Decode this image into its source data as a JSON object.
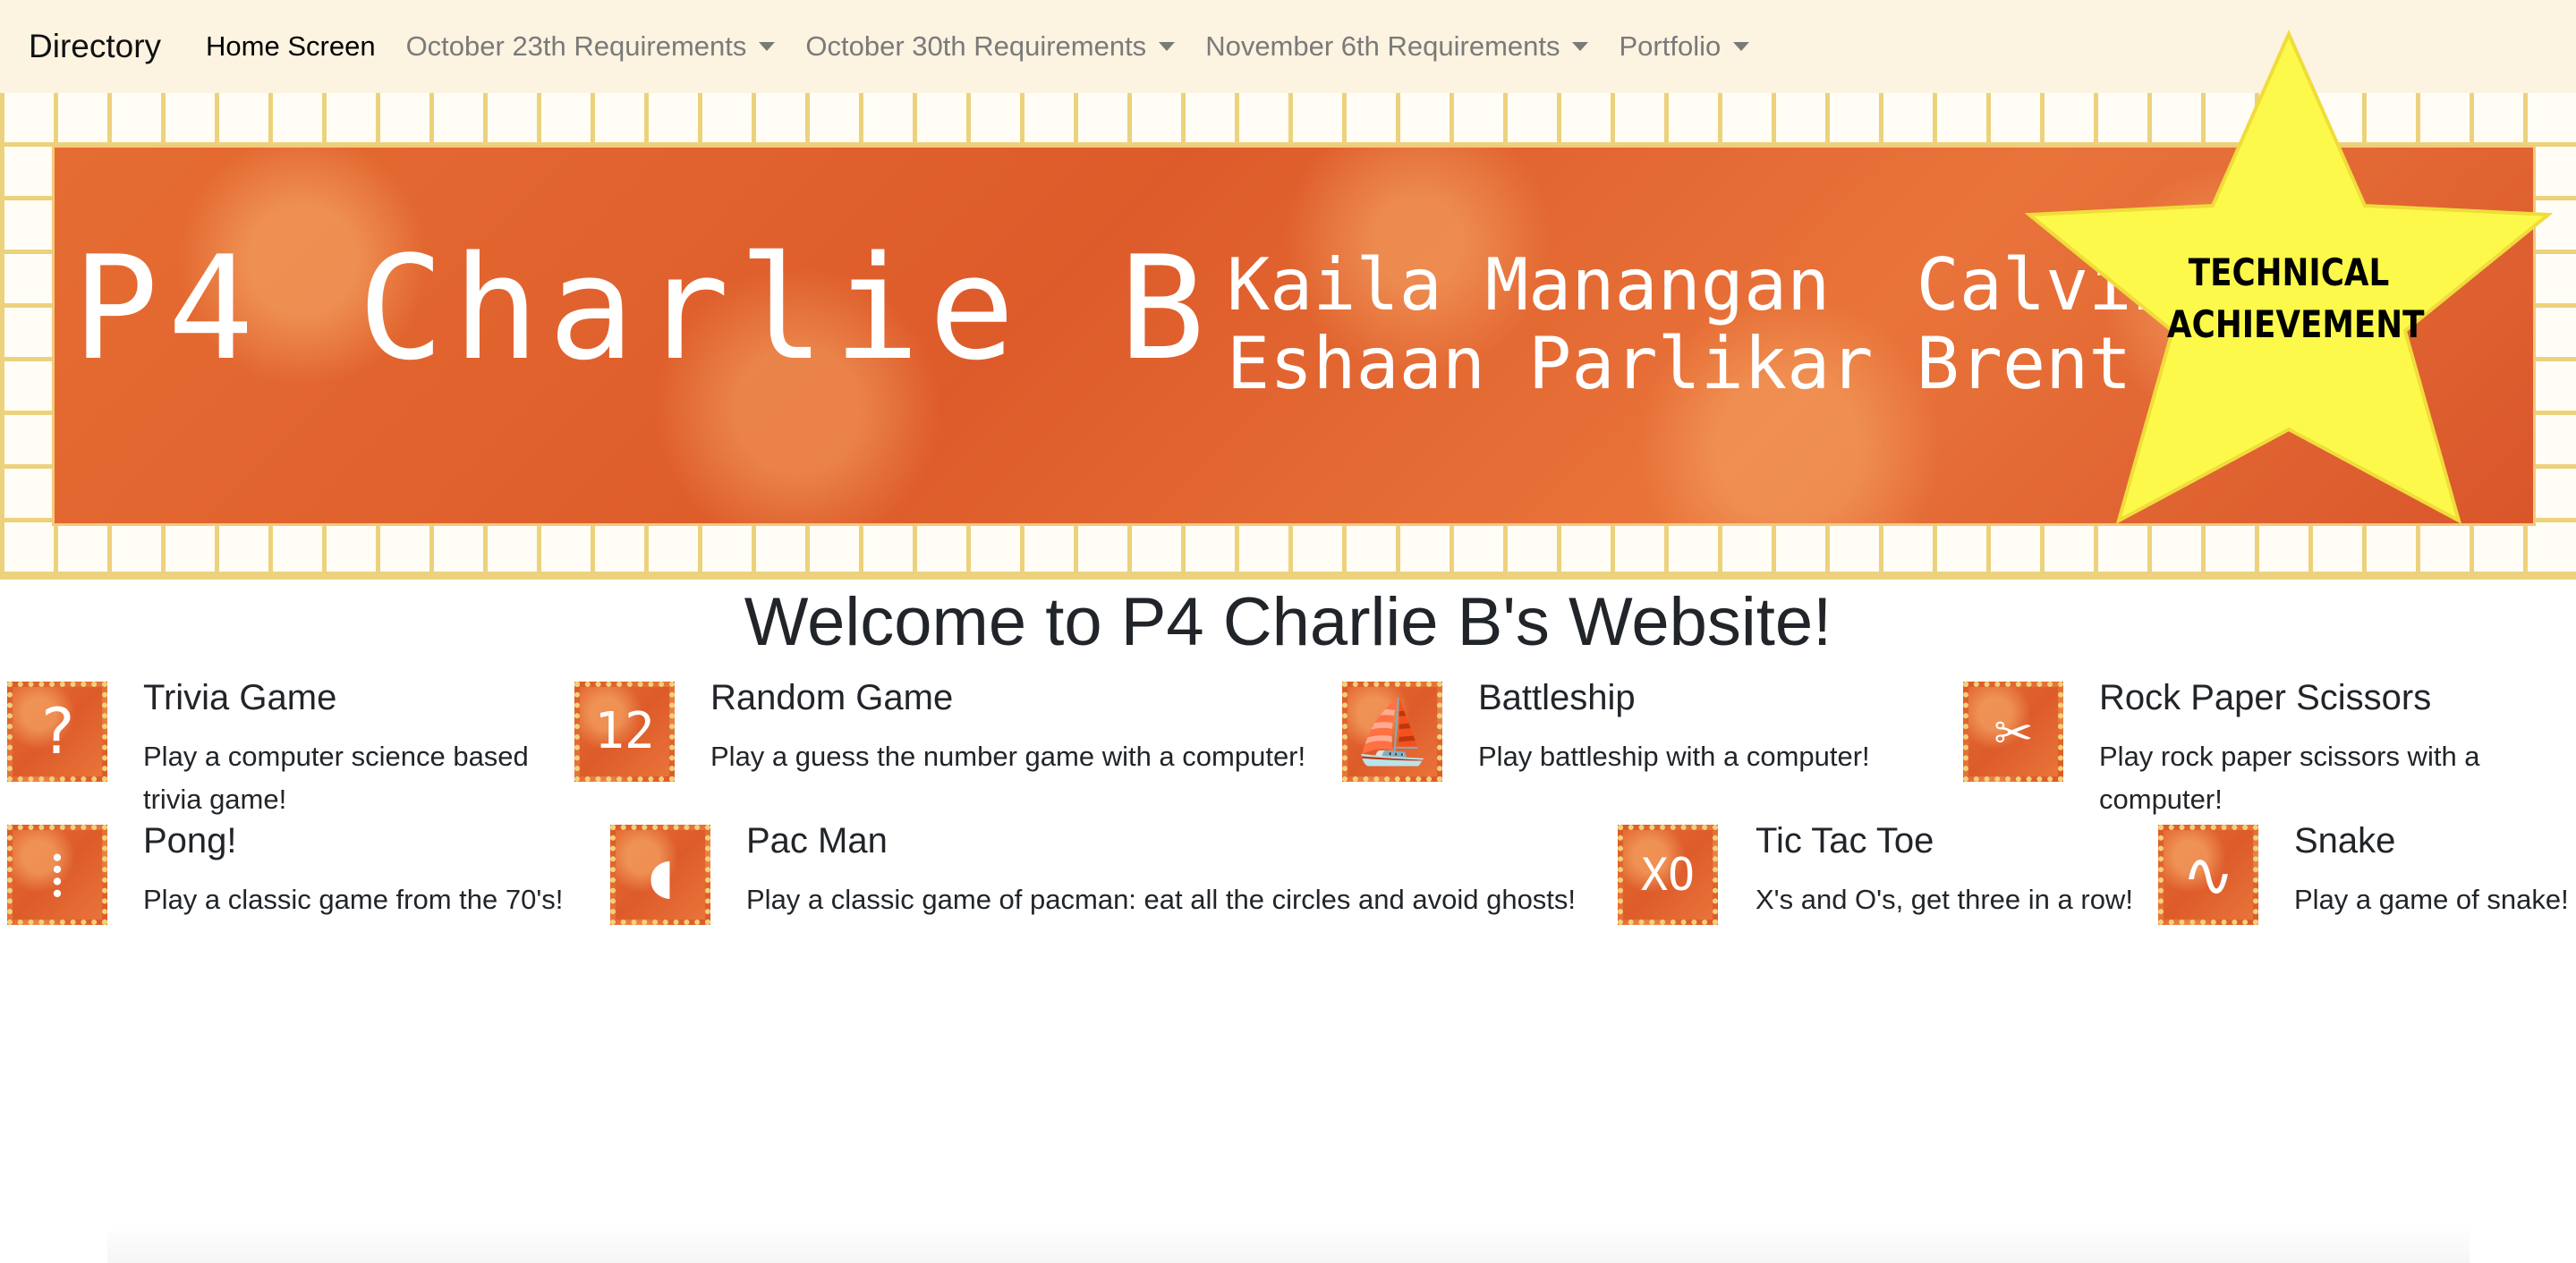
{
  "nav": {
    "brand": "Directory",
    "items": [
      {
        "label": "Home Screen",
        "dropdown": false,
        "active": true
      },
      {
        "label": "October 23th Requirements",
        "dropdown": true
      },
      {
        "label": "October 30th Requirements",
        "dropdown": true
      },
      {
        "label": "November 6th Requirements",
        "dropdown": true
      },
      {
        "label": "Portfolio",
        "dropdown": true
      }
    ]
  },
  "banner": {
    "title": "P4 Charlie B",
    "names_line1": "Kaila Manangan  Calvin",
    "names_line2": "Eshaan Parlikar Brent Hague",
    "badge": [
      "TECHNICAL",
      "ACHIEVEMENT"
    ]
  },
  "welcome": "Welcome to P4 Charlie B's Website!",
  "games": [
    {
      "title": "Trivia Game",
      "desc": "Play a computer science based trivia game!",
      "icon": "question-mark-icon",
      "glyph": "?"
    },
    {
      "title": "Random Game",
      "desc": "Play a guess the number game with a computer!",
      "icon": "number-12-icon",
      "glyph": "12"
    },
    {
      "title": "Battleship",
      "desc": "Play battleship with a computer!",
      "icon": "sailboat-icon",
      "glyph": "⛵"
    },
    {
      "title": "Rock Paper Scissors",
      "desc": "Play rock paper scissors with a computer!",
      "icon": "rock-paper-scissors-icon",
      "glyph": "✂"
    },
    {
      "title": "Pong!",
      "desc": "Play a classic game from the 70's!",
      "icon": "pong-icon",
      "glyph": "⁞"
    },
    {
      "title": "Pac Man",
      "desc": "Play a classic game of pacman: eat all the circles and avoid ghosts!",
      "icon": "pacman-icon",
      "glyph": "◖"
    },
    {
      "title": "Tic Tac Toe",
      "desc": "X's and O's, get three in a row!",
      "icon": "tic-tac-toe-icon",
      "glyph": "XO"
    },
    {
      "title": "Snake",
      "desc": "Play a game of snake!",
      "icon": "snake-icon",
      "glyph": "∿"
    }
  ],
  "colors": {
    "navbar_bg": "#fcf3e0",
    "banner_orange": "#e56d33",
    "grid_gold": "#ecd27c",
    "star_yellow": "#fdf94a"
  }
}
